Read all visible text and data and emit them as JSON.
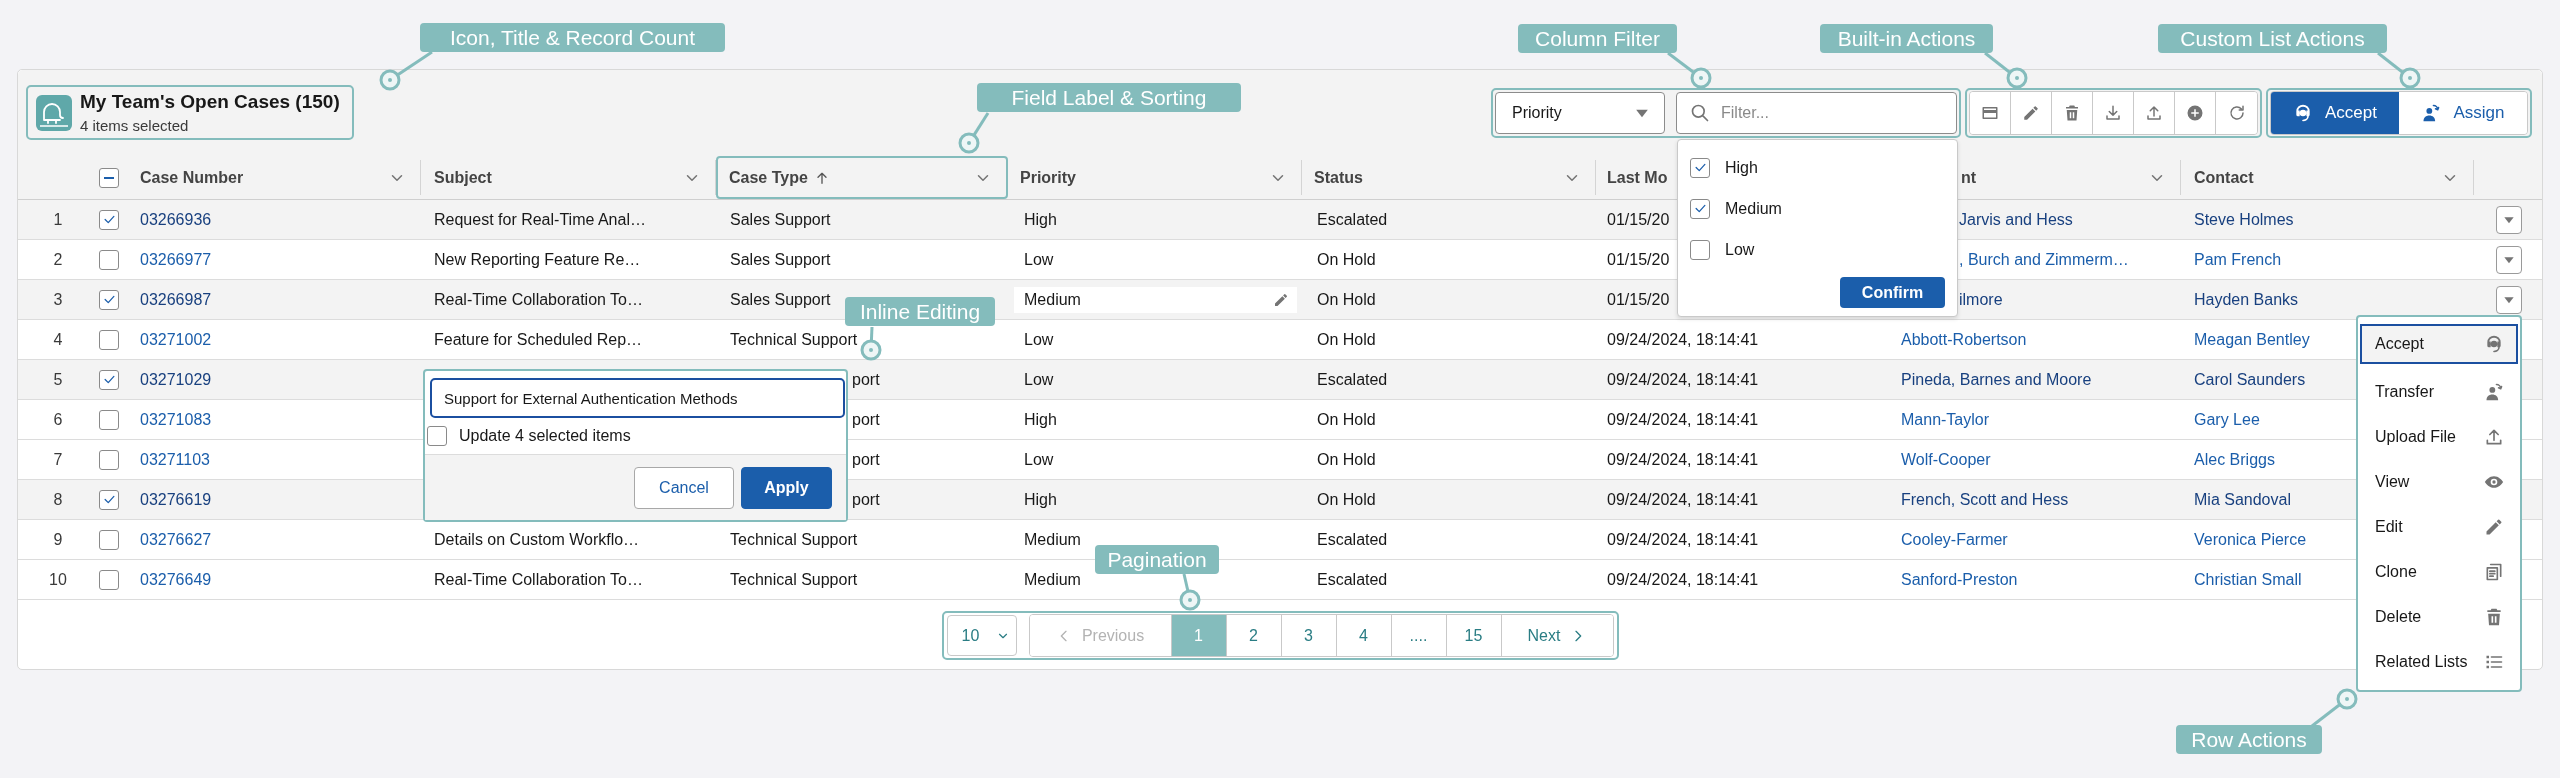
{
  "callouts": [
    {
      "label": "Icon, Title & Record Count"
    },
    {
      "label": "Field Label & Sorting"
    },
    {
      "label": "Column Filter"
    },
    {
      "label": "Built-in Actions"
    },
    {
      "label": "Custom List Actions"
    },
    {
      "label": "Inline Editing"
    },
    {
      "label": "Pagination"
    },
    {
      "label": "Row Actions"
    }
  ],
  "header": {
    "title": "My Team's Open Cases (150)",
    "subtitle": "4 items selected"
  },
  "column_filter": {
    "field": "Priority",
    "placeholder": "Filter...",
    "options": [
      {
        "label": "High",
        "checked": true
      },
      {
        "label": "Medium",
        "checked": true
      },
      {
        "label": "Low",
        "checked": false
      }
    ],
    "confirm": "Confirm"
  },
  "builtin_actions": [
    {
      "kind": "layout"
    },
    {
      "kind": "edit"
    },
    {
      "kind": "delete"
    },
    {
      "kind": "download"
    },
    {
      "kind": "upload"
    },
    {
      "kind": "add"
    },
    {
      "kind": "refresh"
    }
  ],
  "list_actions": [
    {
      "label": "Accept",
      "kind": "accept",
      "primary": true
    },
    {
      "label": "Assign",
      "kind": "assign",
      "primary": false
    }
  ],
  "table": {
    "select_all": {
      "indeterminate": true
    },
    "columns": [
      {
        "label": "Case Number",
        "sorted": false,
        "menu": true,
        "highlighted": false
      },
      {
        "label": "Subject",
        "sorted": false,
        "menu": true,
        "highlighted": false
      },
      {
        "label": "Case Type",
        "sorted": true,
        "menu": true,
        "highlighted": true
      },
      {
        "label": "Priority",
        "sorted": false,
        "menu": true,
        "highlighted": false
      },
      {
        "label": "Status",
        "sorted": false,
        "menu": true,
        "highlighted": false
      },
      {
        "label": "Last Mo"
      },
      {
        "label": "nt",
        "sorted": false,
        "menu": true,
        "highlighted": false
      },
      {
        "label": "Contact",
        "sorted": false,
        "menu": true,
        "highlighted": false
      }
    ],
    "rows": [
      {
        "number": "1",
        "selected": true,
        "case_number": "03266936",
        "subject": "Request for Real-Time Anal…",
        "case_type": "Sales Support",
        "priority": "High",
        "priority_editable": false,
        "status": "Escalated",
        "last_modified": "01/15/20",
        "account": "Jarvis and Hess",
        "contact": "Steve Holmes",
        "menu_button": true
      },
      {
        "number": "2",
        "selected": false,
        "case_number": "03266977",
        "subject": "New Reporting Feature Re…",
        "case_type": "Sales Support",
        "priority": "Low",
        "priority_editable": false,
        "status": "On Hold",
        "last_modified": "01/15/20",
        "account": ", Burch and Zimmerm…",
        "contact": "Pam French",
        "menu_button": true
      },
      {
        "number": "3",
        "selected": true,
        "case_number": "03266987",
        "subject": "Real-Time Collaboration To…",
        "case_type": "Sales Support",
        "priority": "Medium",
        "priority_editable": true,
        "status": "On Hold",
        "last_modified": "01/15/20",
        "account": "ilmore",
        "contact": "Hayden Banks",
        "menu_button": true
      },
      {
        "number": "4",
        "selected": false,
        "case_number": "03271002",
        "subject": "Feature for Scheduled Rep…",
        "case_type": "Technical Support",
        "priority": "Low",
        "priority_editable": false,
        "status": "On Hold",
        "last_modified": "09/24/2024, 18:14:41",
        "account": "Abbott-Robertson",
        "contact": "Meagan Bentley"
      },
      {
        "number": "5",
        "selected": true,
        "case_number": "03271029",
        "case_type": "port",
        "priority": "Low",
        "priority_editable": false,
        "status": "Escalated",
        "last_modified": "09/24/2024, 18:14:41",
        "account": "Pineda, Barnes and Moore",
        "contact": "Carol Saunders"
      },
      {
        "number": "6",
        "selected": false,
        "case_number": "03271083",
        "case_type": "port",
        "priority": "High",
        "priority_editable": false,
        "status": "On Hold",
        "last_modified": "09/24/2024, 18:14:41",
        "account": "Mann-Taylor",
        "contact": "Gary Lee"
      },
      {
        "number": "7",
        "selected": false,
        "case_number": "03271103",
        "case_type": "port",
        "priority": "Low",
        "priority_editable": false,
        "status": "On Hold",
        "last_modified": "09/24/2024, 18:14:41",
        "account": "Wolf-Cooper",
        "contact": "Alec Briggs"
      },
      {
        "number": "8",
        "selected": true,
        "case_number": "03276619",
        "case_type": "port",
        "priority": "High",
        "priority_editable": false,
        "status": "On Hold",
        "last_modified": "09/24/2024, 18:14:41",
        "account": "French, Scott and Hess",
        "contact": "Mia Sandoval"
      },
      {
        "number": "9",
        "selected": false,
        "case_number": "03276627",
        "subject": "Details on Custom Workflo…",
        "case_type": "Technical Support",
        "priority": "Medium",
        "priority_editable": false,
        "status": "Escalated",
        "last_modified": "09/24/2024, 18:14:41",
        "account": "Cooley-Farmer",
        "contact": "Veronica Pierce"
      },
      {
        "number": "10",
        "selected": false,
        "case_number": "03276649",
        "subject": "Real-Time Collaboration To…",
        "case_type": "Technical Support",
        "priority": "Medium",
        "priority_editable": false,
        "status": "Escalated",
        "last_modified": "09/24/2024, 18:14:41",
        "account": "Sanford-Preston",
        "contact": "Christian Small"
      }
    ]
  },
  "inline_edit": {
    "value": "Support for External Authentication Methods",
    "update_all": {
      "label": "Update 4 selected items",
      "checked": false
    },
    "buttons": [
      {
        "label": "Cancel",
        "primary": false
      },
      {
        "label": "Apply",
        "primary": true
      }
    ]
  },
  "row_menu": {
    "items": [
      {
        "label": "Accept",
        "kind": "accept",
        "selected": true
      },
      {
        "label": "Transfer",
        "kind": "transfer",
        "selected": false
      },
      {
        "label": "Upload File",
        "kind": "upload",
        "selected": false
      },
      {
        "label": "View",
        "kind": "view",
        "selected": false
      },
      {
        "label": "Edit",
        "kind": "edit",
        "selected": false
      },
      {
        "label": "Clone",
        "kind": "clone",
        "selected": false
      },
      {
        "label": "Delete",
        "kind": "delete",
        "selected": false
      },
      {
        "label": "Related Lists",
        "kind": "list",
        "selected": false
      }
    ]
  },
  "pagination": {
    "page_size": "10",
    "previous": {
      "label": "Previous",
      "disabled": true
    },
    "pages": [
      {
        "label": "1",
        "selected": true
      },
      {
        "label": "2",
        "selected": false
      },
      {
        "label": "3",
        "selected": false
      },
      {
        "label": "4",
        "selected": false
      },
      {
        "label": "....",
        "selected": false
      },
      {
        "label": "15",
        "selected": false
      }
    ],
    "next": {
      "label": "Next",
      "disabled": false
    }
  }
}
